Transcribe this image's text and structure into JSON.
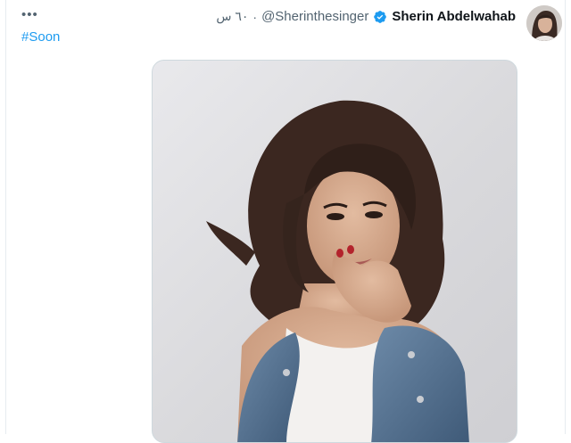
{
  "tweet": {
    "more_label": "•••",
    "hashtag": "#Soon",
    "time": "٦٠ س",
    "handle": "@Sherinthesinger",
    "display_name": "Sherin Abdelwahab"
  },
  "colors": {
    "link": "#1d9bf0",
    "verified": "#1d9bf0",
    "secondary_text": "#536471"
  },
  "icons": {
    "more": "more-icon",
    "verified": "verified-badge-icon"
  }
}
